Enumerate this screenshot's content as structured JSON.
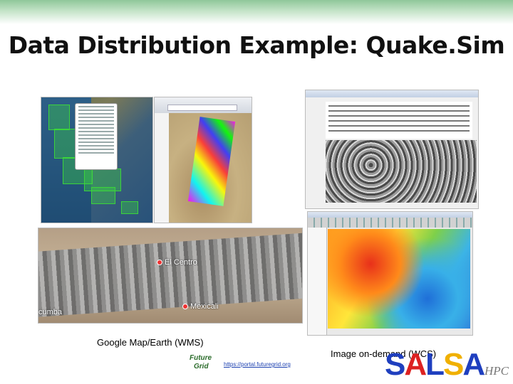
{
  "slide": {
    "title": "Data Distribution Example: Quake.Sim",
    "caption_left": "Google Map/Earth (WMS)",
    "caption_right": "Image on-demand (WCS)",
    "url": "https://portal.futuregrid.org"
  },
  "earth_strip": {
    "places": [
      "El Centro",
      "Mexicali",
      "cumba"
    ]
  },
  "logos": {
    "futuregrid_line1": "Future",
    "futuregrid_line2": "Grid",
    "salsa_letters": [
      "S",
      "A",
      "L",
      "S",
      "A"
    ],
    "salsa_colors": [
      "#1f3fbf",
      "#d22",
      "#1f3fbf",
      "#f0b000",
      "#1f3fbf"
    ],
    "hpc": "HPC"
  },
  "colors": {
    "header_gradient": "#8fc79a",
    "link": "#1a3fb0"
  }
}
